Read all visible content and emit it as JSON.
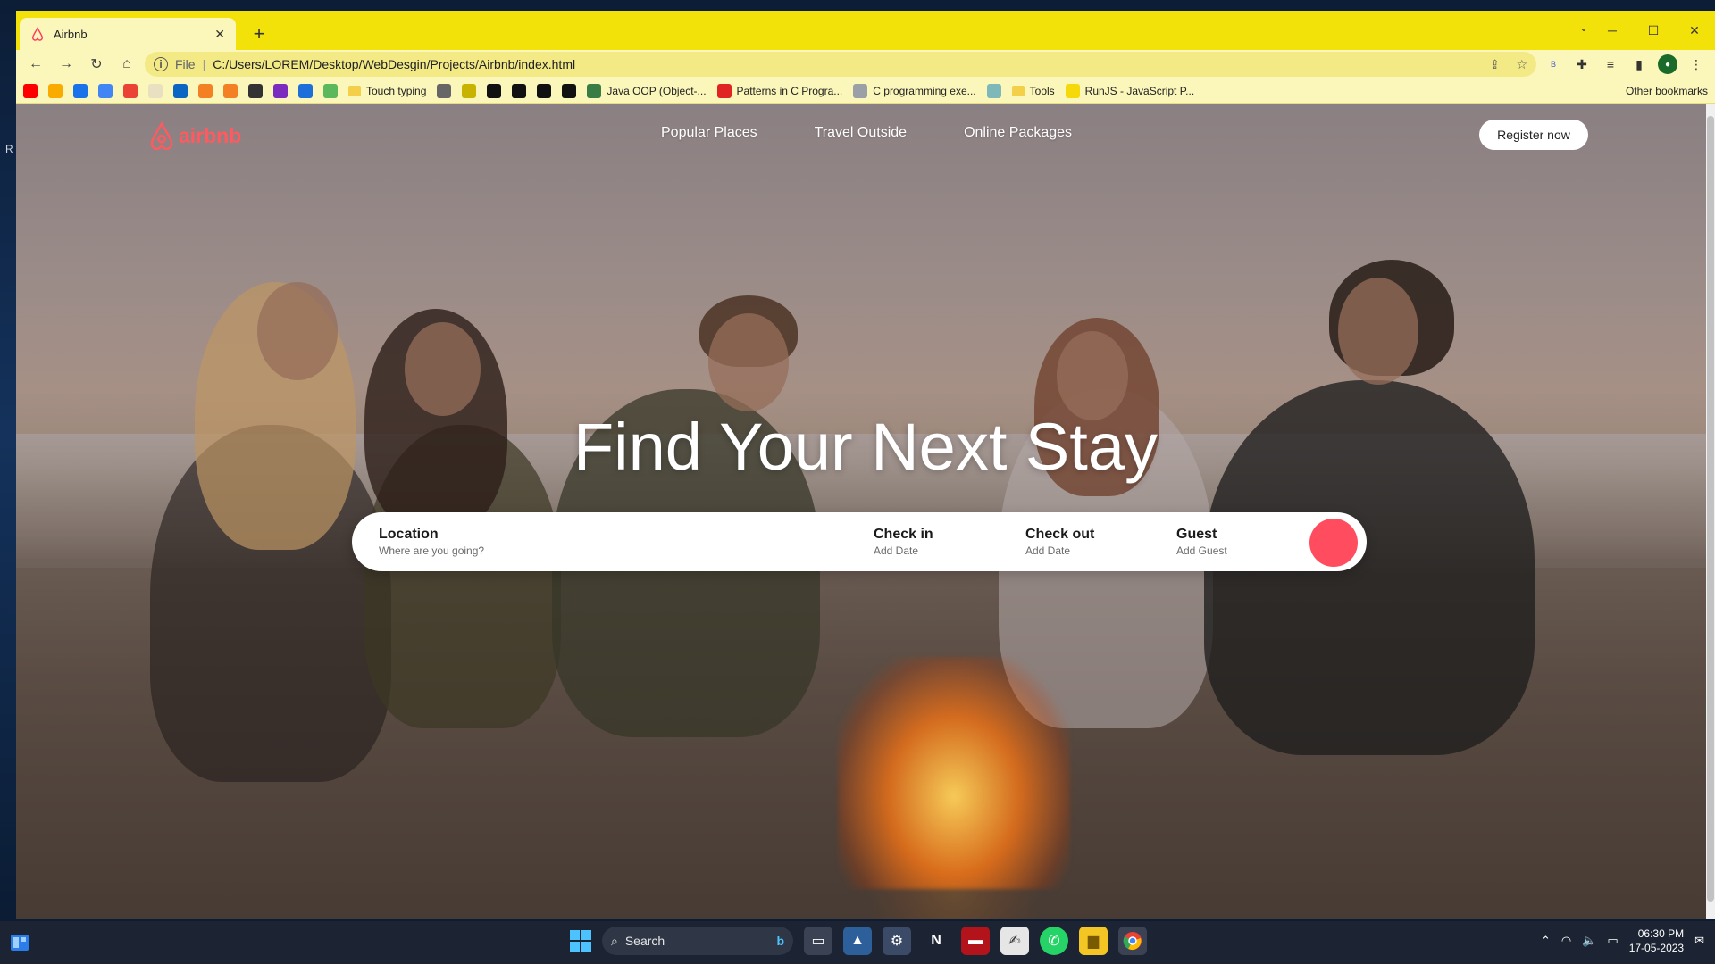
{
  "browser": {
    "tab_title": "Airbnb",
    "url_scheme": "File",
    "url_path": "C:/Users/LOREM/Desktop/WebDesgin/Projects/Airbnb/index.html",
    "bookmarks": [
      {
        "label": "",
        "color": "#ff0000"
      },
      {
        "label": "",
        "color": "#f9ab00"
      },
      {
        "label": "",
        "color": "#1a73e8"
      },
      {
        "label": "",
        "color": "#4285f4"
      },
      {
        "label": "",
        "color": "#ea4335"
      },
      {
        "label": "",
        "color": "#e8e0c0"
      },
      {
        "label": "",
        "color": "#0a66c2"
      },
      {
        "label": "",
        "color": "#f48024"
      },
      {
        "label": "",
        "color": "#f48024"
      },
      {
        "label": "",
        "color": "#333333"
      },
      {
        "label": "",
        "color": "#7b2cbf"
      },
      {
        "label": "",
        "color": "#1e6fd9"
      },
      {
        "label": "",
        "color": "#5cb85c"
      },
      {
        "label": "Touch typing",
        "folder": true
      },
      {
        "label": "",
        "color": "#666666"
      },
      {
        "label": "",
        "color": "#c8b400"
      },
      {
        "label": "",
        "color": "#111111"
      },
      {
        "label": "",
        "color": "#111111"
      },
      {
        "label": "",
        "color": "#111111"
      },
      {
        "label": "",
        "color": "#111111"
      },
      {
        "label": "Java OOP (Object-...",
        "color": "#3a7d44"
      },
      {
        "label": "Patterns in C Progra...",
        "color": "#e02424"
      },
      {
        "label": "C programming exe...",
        "color": "#9aa0a6"
      },
      {
        "label": "",
        "color": "#7fb8b8"
      },
      {
        "label": "Tools",
        "folder": true
      },
      {
        "label": "RunJS - JavaScript P...",
        "color": "#f5d90a"
      }
    ],
    "other_bookmarks": "Other bookmarks"
  },
  "site": {
    "logo_text": "airbnb",
    "nav": [
      "Popular Places",
      "Travel Outside",
      "Online Packages"
    ],
    "register_label": "Register now",
    "headline": "Find Your Next Stay",
    "search": {
      "location_label": "Location",
      "location_sub": "Where are you going?",
      "checkin_label": "Check in",
      "checkin_sub": "Add Date",
      "checkout_label": "Check out",
      "checkout_sub": "Add Date",
      "guest_label": "Guest",
      "guest_sub": "Add Guest"
    },
    "brand_color": "#ff5a5f",
    "button_color": "#ff4d5f"
  },
  "taskbar": {
    "search_label": "Search",
    "time": "06:30 PM",
    "date": "17-05-2023"
  }
}
